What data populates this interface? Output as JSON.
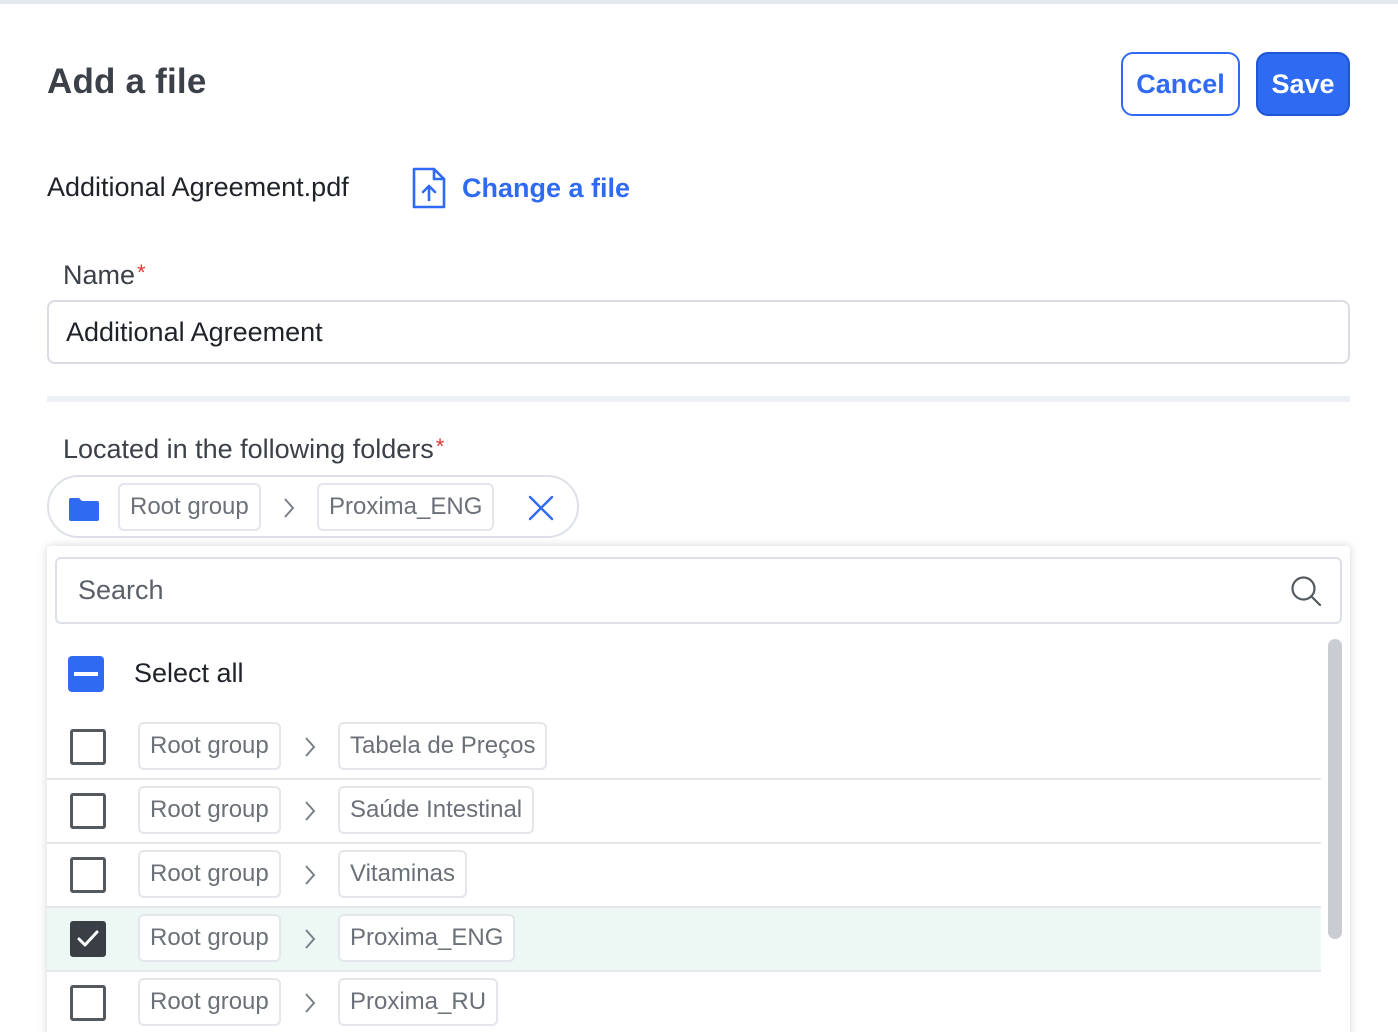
{
  "dialog": {
    "title": "Add a file",
    "cancel_label": "Cancel",
    "save_label": "Save"
  },
  "file": {
    "name": "Additional Agreement.pdf",
    "change_label": "Change a file"
  },
  "name_field": {
    "label": "Name",
    "required_mark": "*",
    "value": "Additional Agreement"
  },
  "folders_field": {
    "label": "Located in the following folders",
    "required_mark": "*",
    "selected": {
      "parent": "Root group",
      "folder": "Proxima_ENG"
    }
  },
  "dropdown": {
    "search_placeholder": "Search",
    "select_all_label": "Select all",
    "items": [
      {
        "parent": "Root group",
        "folder": "Tabela de Preços",
        "checked": false
      },
      {
        "parent": "Root group",
        "folder": "Saúde Intestinal",
        "checked": false
      },
      {
        "parent": "Root group",
        "folder": "Vitaminas",
        "checked": false
      },
      {
        "parent": "Root group",
        "folder": "Proxima_ENG",
        "checked": true
      },
      {
        "parent": "Root group",
        "folder": "Proxima_RU",
        "checked": false
      }
    ]
  },
  "colors": {
    "accent": "#2f6bf2",
    "required": "#e0362f",
    "checked_row_bg": "#edf7f3"
  }
}
